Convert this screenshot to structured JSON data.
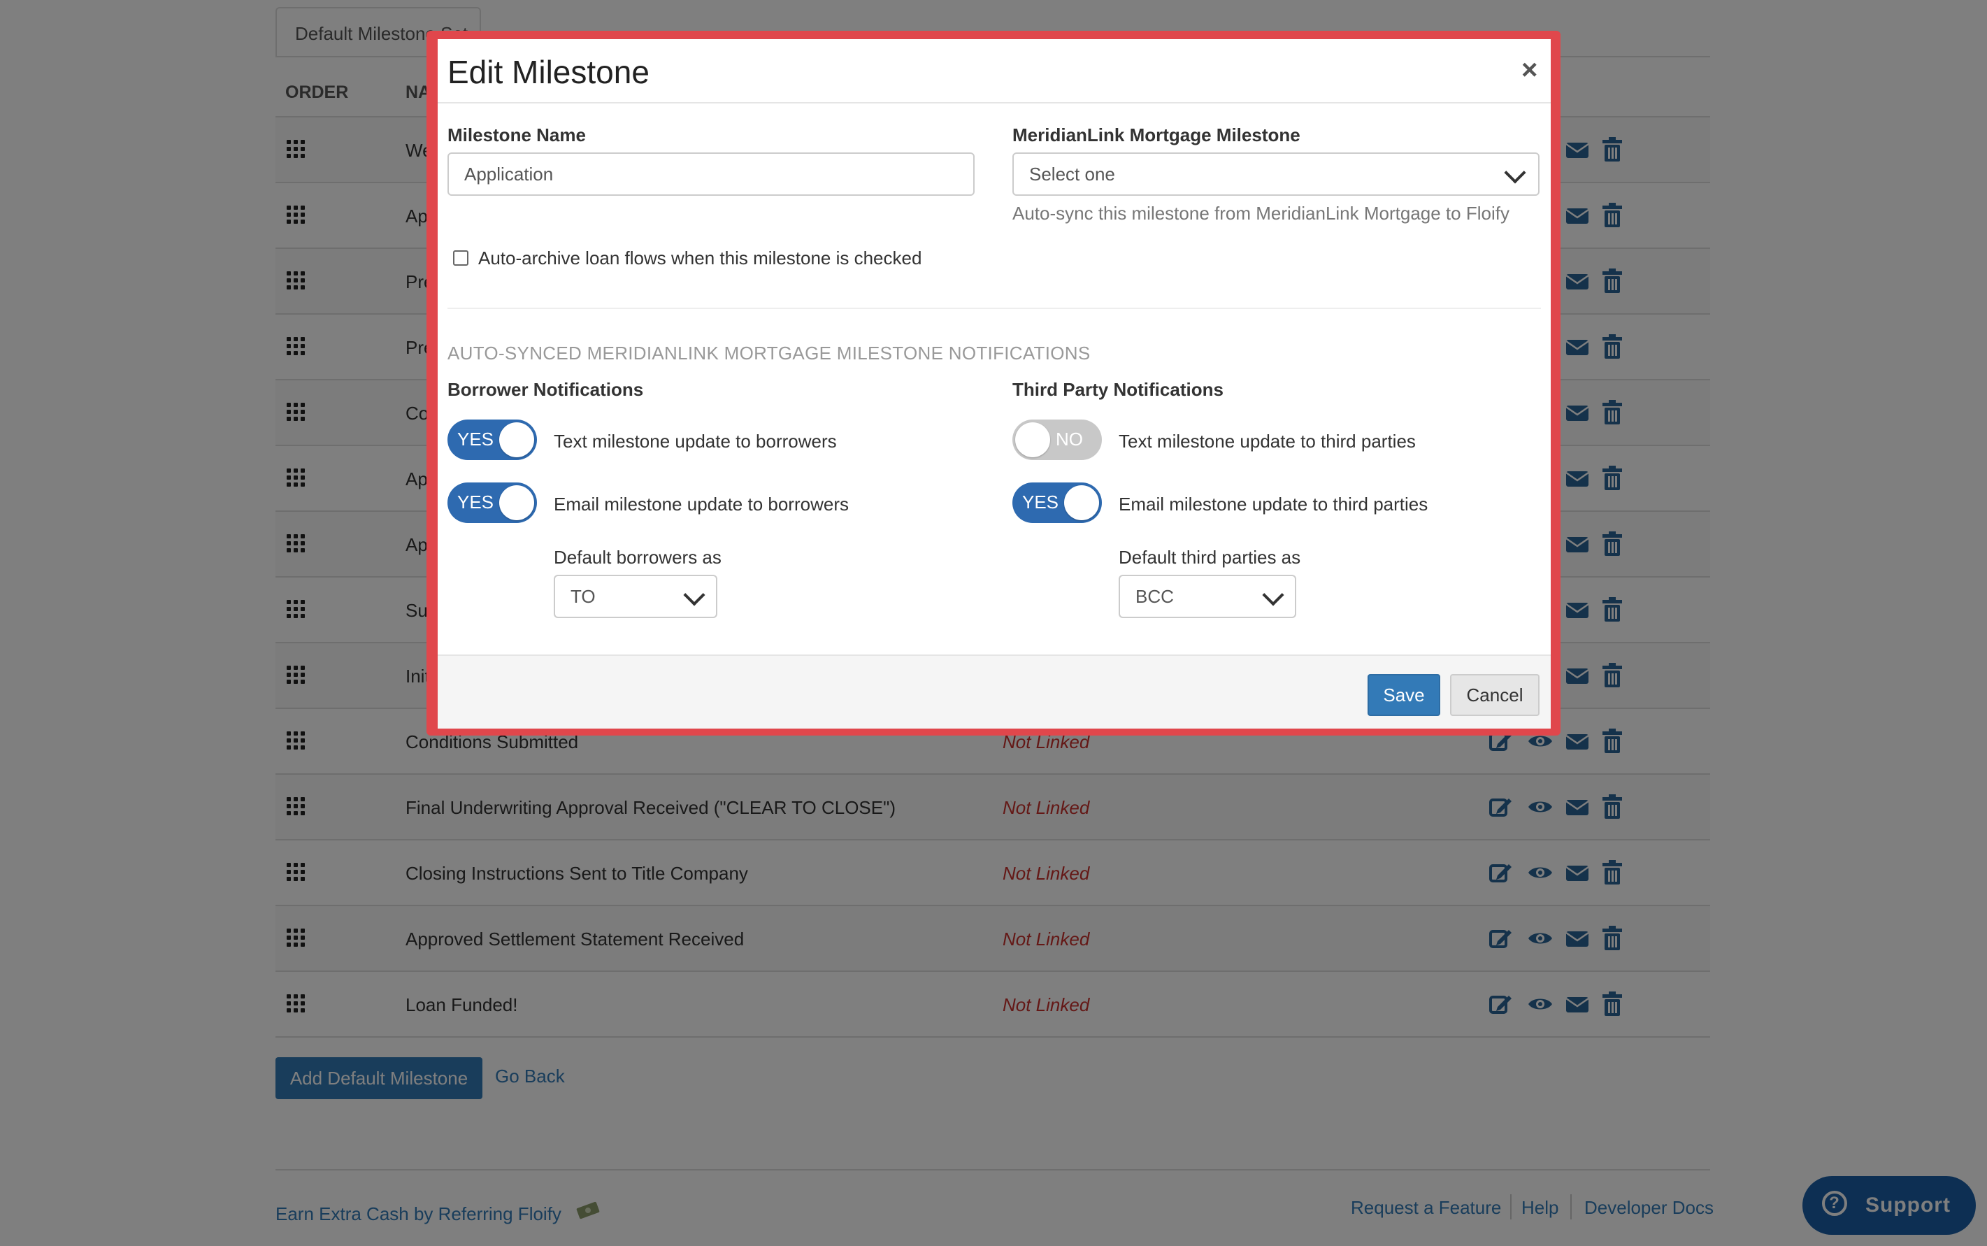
{
  "background": {
    "tab_label": "Default Milestone Set",
    "columns": {
      "order": "ORDER",
      "name": "NA"
    },
    "rows": [
      {
        "name": "We",
        "link": ""
      },
      {
        "name": "Ap",
        "link": ""
      },
      {
        "name": "Pre",
        "link": ""
      },
      {
        "name": "Pre",
        "link": ""
      },
      {
        "name": "Co",
        "link": ""
      },
      {
        "name": "Ap",
        "link": ""
      },
      {
        "name": "Ap",
        "link": ""
      },
      {
        "name": "Su",
        "link": ""
      },
      {
        "name": "Init",
        "link": ""
      },
      {
        "name": "Conditions Submitted",
        "link": "Not Linked"
      },
      {
        "name": "Final Underwriting Approval Received (\"CLEAR TO CLOSE\")",
        "link": "Not Linked"
      },
      {
        "name": "Closing Instructions Sent to Title Company",
        "link": "Not Linked"
      },
      {
        "name": "Approved Settlement Statement Received",
        "link": "Not Linked"
      },
      {
        "name": "Loan Funded!",
        "link": "Not Linked"
      }
    ],
    "add_button": "Add Default Milestone",
    "go_back": "Go Back",
    "footer": {
      "referral": "Earn Extra Cash by Referring Floify",
      "links": [
        "Request a Feature",
        "Help",
        "Developer Docs"
      ]
    },
    "support": "Support"
  },
  "modal": {
    "title": "Edit Milestone",
    "close": "×",
    "milestone_name_label": "Milestone Name",
    "milestone_name_value": "Application",
    "ml_label": "MeridianLink Mortgage Milestone",
    "ml_select": "Select one",
    "ml_help": "Auto-sync this milestone from MeridianLink Mortgage to Floify",
    "auto_archive": "Auto-archive loan flows when this milestone is checked",
    "section_title": "AUTO-SYNCED MERIDIANLINK MORTGAGE MILESTONE NOTIFICATIONS",
    "borrower": {
      "heading": "Borrower Notifications",
      "text_toggle": "YES",
      "text_label": "Text milestone update to borrowers",
      "email_toggle": "YES",
      "email_label": "Email milestone update to borrowers",
      "default_label": "Default borrowers as",
      "default_value": "TO"
    },
    "third_party": {
      "heading": "Third Party Notifications",
      "text_toggle": "NO",
      "text_label": "Text milestone update to third parties",
      "email_toggle": "YES",
      "email_label": "Email milestone update to third parties",
      "default_label": "Default third parties as",
      "default_value": "BCC"
    },
    "save": "Save",
    "cancel": "Cancel"
  },
  "colors": {
    "accent": "#337ab7",
    "modal_border": "#e0474c",
    "toggle_on": "#2e6ab0",
    "not_linked": "#c9302c"
  }
}
